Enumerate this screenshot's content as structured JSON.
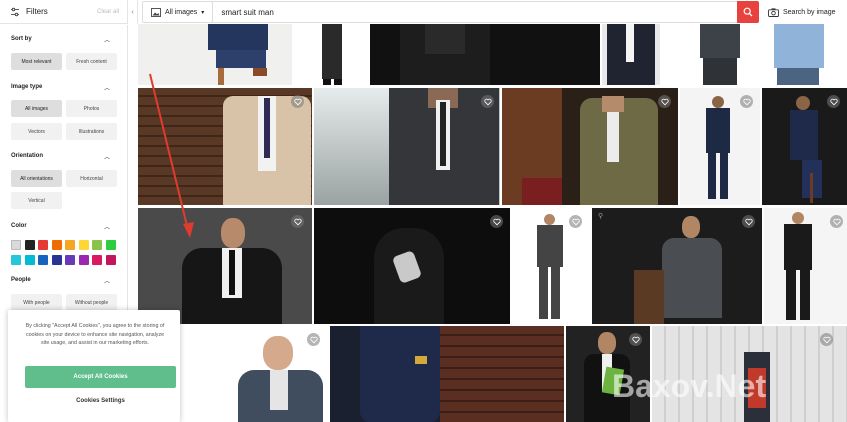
{
  "filters": {
    "title": "Filters",
    "clear_all": "Clear all"
  },
  "search": {
    "image_type": "All images",
    "query": "smart suit man",
    "by_image": "Search by image"
  },
  "sidebar": {
    "sort_by": {
      "title": "Sort by",
      "options": [
        "Most relevant",
        "Fresh content"
      ]
    },
    "image_type": {
      "title": "Image type",
      "options": [
        "All images",
        "Photos",
        "Vectors",
        "Illustrations"
      ]
    },
    "orientation": {
      "title": "Orientation",
      "options": [
        "All orientations",
        "Horizontal",
        "Vertical"
      ]
    },
    "color": {
      "title": "Color",
      "swatches": [
        "#d9d9d9",
        "#222222",
        "#e53935",
        "#ef6c00",
        "#f5a623",
        "#fdd835",
        "#8bc34a",
        "#2ecc40",
        "#26c6da",
        "#00bcd4",
        "#1565c0",
        "#283593",
        "#673ab7",
        "#9c27b0",
        "#d81b60",
        "#c2185b"
      ]
    },
    "people": {
      "title": "People",
      "options": [
        "With people",
        "Without people"
      ]
    }
  },
  "cookie": {
    "text": "By clicking \"Accept All Cookies\", you agree to the storing of cookies on your device to enhance site navigation, analyze site usage, and assist in our marketing efforts.",
    "accept": "Accept All Cookies",
    "settings": "Cookies Settings"
  },
  "watermark": "Baxov.Net",
  "colors": {
    "accent": "#e8423e",
    "accept": "#5fbe8c"
  }
}
